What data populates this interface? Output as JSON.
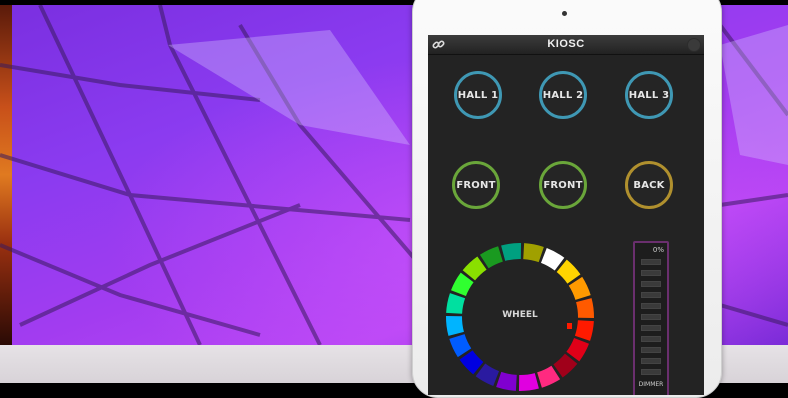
{
  "app": {
    "title": "KIOSC"
  },
  "icons": {
    "link": "link-icon",
    "menu": "menu-dot-icon"
  },
  "buttons": {
    "row1": [
      {
        "label": "HALL 1",
        "color": "#3f98b4"
      },
      {
        "label": "HALL 2",
        "color": "#3f98b4"
      },
      {
        "label": "HALL 3",
        "color": "#3f98b4"
      }
    ],
    "row2": [
      {
        "label": "FRONT",
        "color": "#6aa63a"
      },
      {
        "label": "FRONT",
        "color": "#6aa63a"
      },
      {
        "label": "BACK",
        "color": "#b0902e"
      }
    ]
  },
  "wheel": {
    "label": "WHEEL",
    "segment_colors": [
      "#ffffff",
      "#ffd400",
      "#ff9a00",
      "#ff5a00",
      "#ff1a00",
      "#e00018",
      "#a0001a",
      "#ff2a80",
      "#e000e0",
      "#8000d0",
      "#2a1aa0",
      "#0000e0",
      "#005cff",
      "#00b4ff",
      "#00e0a0",
      "#30ff30",
      "#8ae000",
      "#1a9a20",
      "#00a080",
      "#a0a000"
    ],
    "selected_color": "#ff1a00"
  },
  "dimmer": {
    "value": "0%",
    "label": "DIMMER",
    "level": 0
  }
}
